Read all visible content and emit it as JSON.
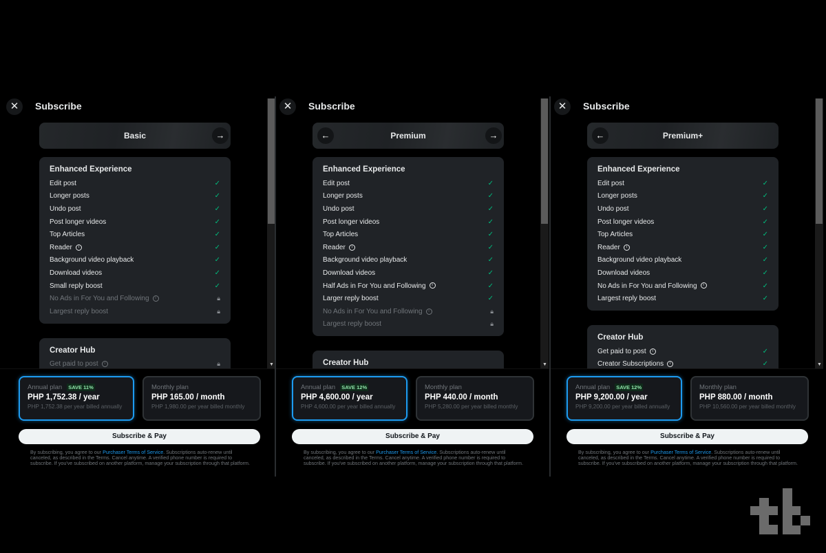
{
  "header_title": "Subscribe",
  "subscribe_button": "Subscribe & Pay",
  "legal": {
    "prefix": "By subscribing, you agree to our ",
    "link": "Purchaser Terms of Service",
    "suffix": ". Subscriptions auto-renew until canceled, as described in the Terms. Cancel anytime. A verified phone number is required to subscribe. If you've subscribed on another platform, manage your subscription through that platform."
  },
  "colors": {
    "accent": "#1d9bf0",
    "check": "#00ba7c",
    "save": "#8ee3a8"
  },
  "panels": [
    {
      "tier": "Basic",
      "has_prev": false,
      "has_next": true,
      "sections": [
        {
          "title": "Enhanced Experience",
          "items": [
            {
              "label": "Edit post",
              "status": "check"
            },
            {
              "label": "Longer posts",
              "status": "check"
            },
            {
              "label": "Undo post",
              "status": "check"
            },
            {
              "label": "Post longer videos",
              "status": "check"
            },
            {
              "label": "Top Articles",
              "status": "check"
            },
            {
              "label": "Reader",
              "status": "check",
              "info": true
            },
            {
              "label": "Background video playback",
              "status": "check"
            },
            {
              "label": "Download videos",
              "status": "check"
            },
            {
              "label": "Small reply boost",
              "status": "check"
            },
            {
              "label": "No Ads in For You and Following",
              "status": "lock",
              "info": true
            },
            {
              "label": "Largest reply boost",
              "status": "lock"
            }
          ]
        },
        {
          "title": "Creator Hub",
          "items": [
            {
              "label": "Get paid to post",
              "status": "lock",
              "info": true
            }
          ]
        }
      ],
      "annual": {
        "label": "Annual plan",
        "save": "SAVE 11%",
        "price": "PHP 1,752.38 / year",
        "sub": "PHP 1,752.38 per year billed annually"
      },
      "monthly": {
        "label": "Monthly plan",
        "price": "PHP 165.00 / month",
        "sub": "PHP 1,980.00 per year billed monthly"
      }
    },
    {
      "tier": "Premium",
      "has_prev": true,
      "has_next": true,
      "sections": [
        {
          "title": "Enhanced Experience",
          "items": [
            {
              "label": "Edit post",
              "status": "check"
            },
            {
              "label": "Longer posts",
              "status": "check"
            },
            {
              "label": "Undo post",
              "status": "check"
            },
            {
              "label": "Post longer videos",
              "status": "check"
            },
            {
              "label": "Top Articles",
              "status": "check"
            },
            {
              "label": "Reader",
              "status": "check",
              "info": true
            },
            {
              "label": "Background video playback",
              "status": "check"
            },
            {
              "label": "Download videos",
              "status": "check"
            },
            {
              "label": "Half Ads in For You and Following",
              "status": "check",
              "info": true
            },
            {
              "label": "Larger reply boost",
              "status": "check"
            },
            {
              "label": "No Ads in For You and Following",
              "status": "lock",
              "info": true
            },
            {
              "label": "Largest reply boost",
              "status": "lock"
            }
          ]
        },
        {
          "title": "Creator Hub",
          "items": []
        }
      ],
      "annual": {
        "label": "Annual plan",
        "save": "SAVE 12%",
        "price": "PHP 4,600.00 / year",
        "sub": "PHP 4,600.00 per year billed annually"
      },
      "monthly": {
        "label": "Monthly plan",
        "price": "PHP 440.00 / month",
        "sub": "PHP 5,280.00 per year billed monthly"
      }
    },
    {
      "tier": "Premium+",
      "has_prev": true,
      "has_next": false,
      "sections": [
        {
          "title": "Enhanced Experience",
          "items": [
            {
              "label": "Edit post",
              "status": "check"
            },
            {
              "label": "Longer posts",
              "status": "check"
            },
            {
              "label": "Undo post",
              "status": "check"
            },
            {
              "label": "Post longer videos",
              "status": "check"
            },
            {
              "label": "Top Articles",
              "status": "check"
            },
            {
              "label": "Reader",
              "status": "check",
              "info": true
            },
            {
              "label": "Background video playback",
              "status": "check"
            },
            {
              "label": "Download videos",
              "status": "check"
            },
            {
              "label": "No Ads in For You and Following",
              "status": "check",
              "info": true
            },
            {
              "label": "Largest reply boost",
              "status": "check"
            }
          ]
        },
        {
          "title": "Creator Hub",
          "items": [
            {
              "label": "Get paid to post",
              "status": "check",
              "info": true
            },
            {
              "label": "Creator Subscriptions",
              "status": "check",
              "info": true
            }
          ]
        }
      ],
      "annual": {
        "label": "Annual plan",
        "save": "SAVE 12%",
        "price": "PHP 9,200.00 / year",
        "sub": "PHP 9,200.00 per year billed annually"
      },
      "monthly": {
        "label": "Monthly plan",
        "price": "PHP 880.00 / month",
        "sub": "PHP 10,560.00 per year billed monthly"
      }
    }
  ],
  "watermark_logo": "tb"
}
